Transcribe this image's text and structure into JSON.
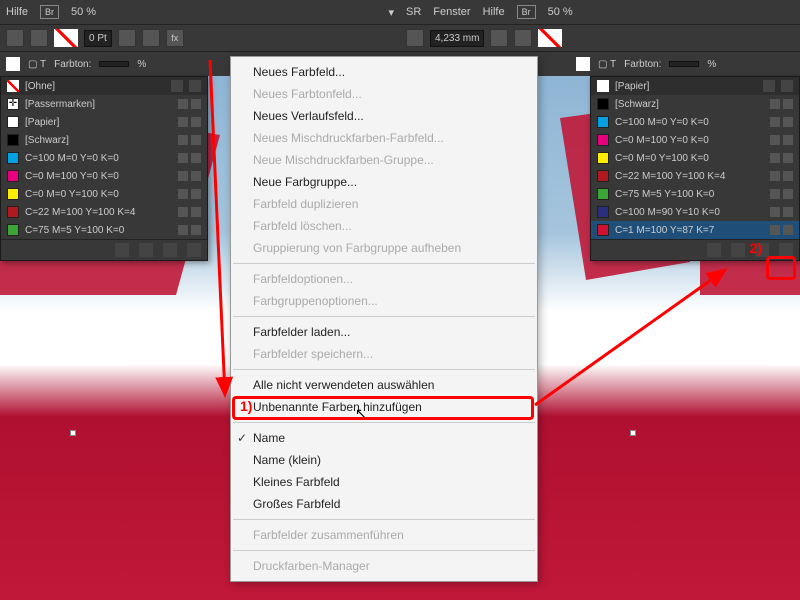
{
  "menubar": {
    "hilfe": "Hilfe",
    "br": "Br",
    "zoom": "50 %",
    "sr": "SR",
    "fenster": "Fenster"
  },
  "toolbar": {
    "pt": "0 Pt",
    "mm": "4,233 mm"
  },
  "toolbar2": {
    "farbton": "Farbton:",
    "pct": "%"
  },
  "panel_left": {
    "header": "[Ohne]",
    "rows": [
      {
        "name": "[Passermarken]",
        "color": "#ffffff",
        "reg": true
      },
      {
        "name": "[Papier]",
        "color": "#ffffff"
      },
      {
        "name": "[Schwarz]",
        "color": "#000000"
      },
      {
        "name": "C=100 M=0 Y=0 K=0",
        "color": "#00a0e3"
      },
      {
        "name": "C=0 M=100 Y=0 K=0",
        "color": "#e6007e"
      },
      {
        "name": "C=0 M=0 Y=100 K=0",
        "color": "#ffed00"
      },
      {
        "name": "C=22 M=100 Y=100 K=4",
        "color": "#b01a1f"
      },
      {
        "name": "C=75 M=5 Y=100 K=0",
        "color": "#3aa535"
      }
    ]
  },
  "panel_right": {
    "header": "[Papier]",
    "rows": [
      {
        "name": "[Schwarz]",
        "color": "#000000"
      },
      {
        "name": "C=100 M=0 Y=0 K=0",
        "color": "#00a0e3"
      },
      {
        "name": "C=0 M=100 Y=0 K=0",
        "color": "#e6007e"
      },
      {
        "name": "C=0 M=0 Y=100 K=0",
        "color": "#ffed00"
      },
      {
        "name": "C=22 M=100 Y=100 K=4",
        "color": "#b01a1f"
      },
      {
        "name": "C=75 M=5 Y=100 K=0",
        "color": "#3aa535"
      },
      {
        "name": "C=100 M=90 Y=10 K=0",
        "color": "#2a2f7d"
      },
      {
        "name": "C=1 M=100 Y=87 K=7",
        "color": "#d01030",
        "sel": true
      }
    ]
  },
  "ctx": {
    "items": [
      {
        "label": "Neues Farbfeld...",
        "en": true
      },
      {
        "label": "Neues Farbtonfeld...",
        "en": false
      },
      {
        "label": "Neues Verlaufsfeld...",
        "en": true
      },
      {
        "label": "Neues Mischdruckfarben-Farbfeld...",
        "en": false
      },
      {
        "label": "Neue Mischdruckfarben-Gruppe...",
        "en": false
      },
      {
        "label": "Neue Farbgruppe...",
        "en": true
      },
      {
        "label": "Farbfeld duplizieren",
        "en": false
      },
      {
        "label": "Farbfeld löschen...",
        "en": false
      },
      {
        "label": "Gruppierung von Farbgruppe aufheben",
        "en": false
      },
      {
        "sep": true
      },
      {
        "label": "Farbfeldoptionen...",
        "en": false
      },
      {
        "label": "Farbgruppenoptionen...",
        "en": false
      },
      {
        "sep": true
      },
      {
        "label": "Farbfelder laden...",
        "en": true
      },
      {
        "label": "Farbfelder speichern...",
        "en": false
      },
      {
        "sep": true
      },
      {
        "label": "Alle nicht verwendeten auswählen",
        "en": true,
        "hl": true
      },
      {
        "label": "Unbenannte Farben hinzufügen",
        "en": true
      },
      {
        "sep": true
      },
      {
        "label": "Name",
        "en": true,
        "chk": true
      },
      {
        "label": "Name (klein)",
        "en": true
      },
      {
        "label": "Kleines Farbfeld",
        "en": true
      },
      {
        "label": "Großes Farbfeld",
        "en": true
      },
      {
        "sep": true
      },
      {
        "label": "Farbfelder zusammenführen",
        "en": false
      },
      {
        "sep": true
      },
      {
        "label": "Druckfarben-Manager",
        "en": false
      }
    ]
  },
  "annot": {
    "one": "1)",
    "two": "2)"
  }
}
